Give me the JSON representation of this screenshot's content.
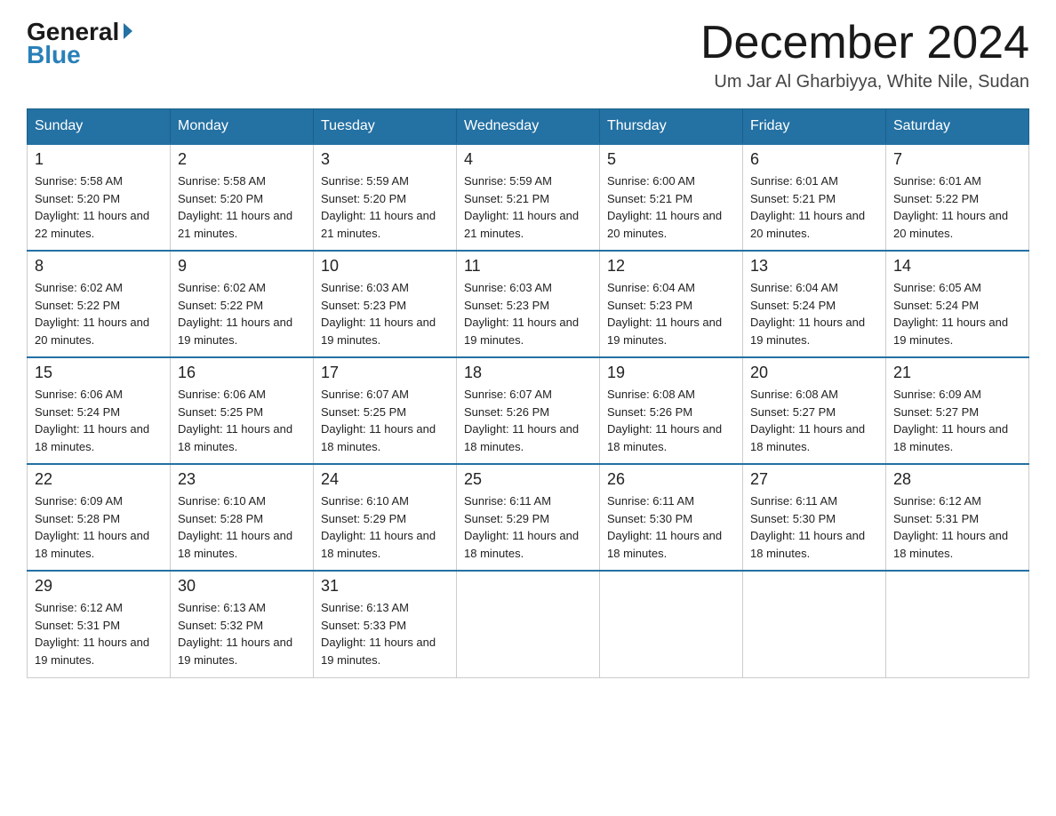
{
  "header": {
    "logo_general": "General",
    "logo_blue": "Blue",
    "month_title": "December 2024",
    "subtitle": "Um Jar Al Gharbiyya, White Nile, Sudan"
  },
  "days_of_week": [
    "Sunday",
    "Monday",
    "Tuesday",
    "Wednesday",
    "Thursday",
    "Friday",
    "Saturday"
  ],
  "weeks": [
    [
      {
        "day": "1",
        "sunrise": "Sunrise: 5:58 AM",
        "sunset": "Sunset: 5:20 PM",
        "daylight": "Daylight: 11 hours and 22 minutes."
      },
      {
        "day": "2",
        "sunrise": "Sunrise: 5:58 AM",
        "sunset": "Sunset: 5:20 PM",
        "daylight": "Daylight: 11 hours and 21 minutes."
      },
      {
        "day": "3",
        "sunrise": "Sunrise: 5:59 AM",
        "sunset": "Sunset: 5:20 PM",
        "daylight": "Daylight: 11 hours and 21 minutes."
      },
      {
        "day": "4",
        "sunrise": "Sunrise: 5:59 AM",
        "sunset": "Sunset: 5:21 PM",
        "daylight": "Daylight: 11 hours and 21 minutes."
      },
      {
        "day": "5",
        "sunrise": "Sunrise: 6:00 AM",
        "sunset": "Sunset: 5:21 PM",
        "daylight": "Daylight: 11 hours and 20 minutes."
      },
      {
        "day": "6",
        "sunrise": "Sunrise: 6:01 AM",
        "sunset": "Sunset: 5:21 PM",
        "daylight": "Daylight: 11 hours and 20 minutes."
      },
      {
        "day": "7",
        "sunrise": "Sunrise: 6:01 AM",
        "sunset": "Sunset: 5:22 PM",
        "daylight": "Daylight: 11 hours and 20 minutes."
      }
    ],
    [
      {
        "day": "8",
        "sunrise": "Sunrise: 6:02 AM",
        "sunset": "Sunset: 5:22 PM",
        "daylight": "Daylight: 11 hours and 20 minutes."
      },
      {
        "day": "9",
        "sunrise": "Sunrise: 6:02 AM",
        "sunset": "Sunset: 5:22 PM",
        "daylight": "Daylight: 11 hours and 19 minutes."
      },
      {
        "day": "10",
        "sunrise": "Sunrise: 6:03 AM",
        "sunset": "Sunset: 5:23 PM",
        "daylight": "Daylight: 11 hours and 19 minutes."
      },
      {
        "day": "11",
        "sunrise": "Sunrise: 6:03 AM",
        "sunset": "Sunset: 5:23 PM",
        "daylight": "Daylight: 11 hours and 19 minutes."
      },
      {
        "day": "12",
        "sunrise": "Sunrise: 6:04 AM",
        "sunset": "Sunset: 5:23 PM",
        "daylight": "Daylight: 11 hours and 19 minutes."
      },
      {
        "day": "13",
        "sunrise": "Sunrise: 6:04 AM",
        "sunset": "Sunset: 5:24 PM",
        "daylight": "Daylight: 11 hours and 19 minutes."
      },
      {
        "day": "14",
        "sunrise": "Sunrise: 6:05 AM",
        "sunset": "Sunset: 5:24 PM",
        "daylight": "Daylight: 11 hours and 19 minutes."
      }
    ],
    [
      {
        "day": "15",
        "sunrise": "Sunrise: 6:06 AM",
        "sunset": "Sunset: 5:24 PM",
        "daylight": "Daylight: 11 hours and 18 minutes."
      },
      {
        "day": "16",
        "sunrise": "Sunrise: 6:06 AM",
        "sunset": "Sunset: 5:25 PM",
        "daylight": "Daylight: 11 hours and 18 minutes."
      },
      {
        "day": "17",
        "sunrise": "Sunrise: 6:07 AM",
        "sunset": "Sunset: 5:25 PM",
        "daylight": "Daylight: 11 hours and 18 minutes."
      },
      {
        "day": "18",
        "sunrise": "Sunrise: 6:07 AM",
        "sunset": "Sunset: 5:26 PM",
        "daylight": "Daylight: 11 hours and 18 minutes."
      },
      {
        "day": "19",
        "sunrise": "Sunrise: 6:08 AM",
        "sunset": "Sunset: 5:26 PM",
        "daylight": "Daylight: 11 hours and 18 minutes."
      },
      {
        "day": "20",
        "sunrise": "Sunrise: 6:08 AM",
        "sunset": "Sunset: 5:27 PM",
        "daylight": "Daylight: 11 hours and 18 minutes."
      },
      {
        "day": "21",
        "sunrise": "Sunrise: 6:09 AM",
        "sunset": "Sunset: 5:27 PM",
        "daylight": "Daylight: 11 hours and 18 minutes."
      }
    ],
    [
      {
        "day": "22",
        "sunrise": "Sunrise: 6:09 AM",
        "sunset": "Sunset: 5:28 PM",
        "daylight": "Daylight: 11 hours and 18 minutes."
      },
      {
        "day": "23",
        "sunrise": "Sunrise: 6:10 AM",
        "sunset": "Sunset: 5:28 PM",
        "daylight": "Daylight: 11 hours and 18 minutes."
      },
      {
        "day": "24",
        "sunrise": "Sunrise: 6:10 AM",
        "sunset": "Sunset: 5:29 PM",
        "daylight": "Daylight: 11 hours and 18 minutes."
      },
      {
        "day": "25",
        "sunrise": "Sunrise: 6:11 AM",
        "sunset": "Sunset: 5:29 PM",
        "daylight": "Daylight: 11 hours and 18 minutes."
      },
      {
        "day": "26",
        "sunrise": "Sunrise: 6:11 AM",
        "sunset": "Sunset: 5:30 PM",
        "daylight": "Daylight: 11 hours and 18 minutes."
      },
      {
        "day": "27",
        "sunrise": "Sunrise: 6:11 AM",
        "sunset": "Sunset: 5:30 PM",
        "daylight": "Daylight: 11 hours and 18 minutes."
      },
      {
        "day": "28",
        "sunrise": "Sunrise: 6:12 AM",
        "sunset": "Sunset: 5:31 PM",
        "daylight": "Daylight: 11 hours and 18 minutes."
      }
    ],
    [
      {
        "day": "29",
        "sunrise": "Sunrise: 6:12 AM",
        "sunset": "Sunset: 5:31 PM",
        "daylight": "Daylight: 11 hours and 19 minutes."
      },
      {
        "day": "30",
        "sunrise": "Sunrise: 6:13 AM",
        "sunset": "Sunset: 5:32 PM",
        "daylight": "Daylight: 11 hours and 19 minutes."
      },
      {
        "day": "31",
        "sunrise": "Sunrise: 6:13 AM",
        "sunset": "Sunset: 5:33 PM",
        "daylight": "Daylight: 11 hours and 19 minutes."
      },
      null,
      null,
      null,
      null
    ]
  ]
}
